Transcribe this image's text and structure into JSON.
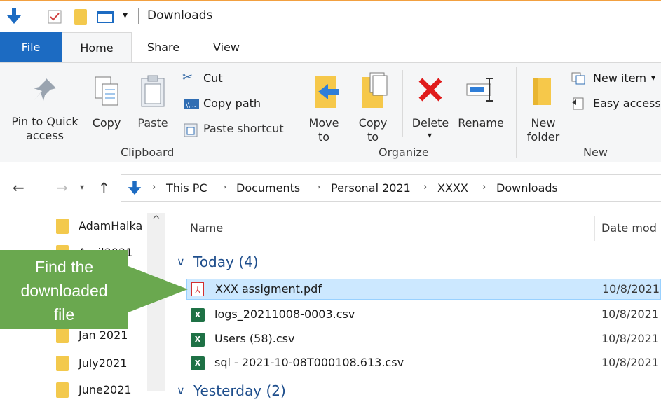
{
  "window": {
    "title": "Downloads"
  },
  "tabs": {
    "file": "File",
    "home": "Home",
    "share": "Share",
    "view": "View"
  },
  "ribbon": {
    "clipboard": {
      "pin": "Pin to Quick access",
      "copy": "Copy",
      "paste": "Paste",
      "cut": "Cut",
      "copy_path": "Copy path",
      "paste_shortcut": "Paste shortcut",
      "group": "Clipboard"
    },
    "organize": {
      "move_to": "Move to",
      "copy_to": "Copy to",
      "delete": "Delete",
      "rename": "Rename",
      "group": "Organize"
    },
    "new": {
      "new_folder": "New folder",
      "new_item": "New item",
      "easy_access": "Easy access",
      "group": "New"
    }
  },
  "address": {
    "crumbs": [
      "This PC",
      "Documents",
      "Personal 2021",
      "XXXX",
      "Downloads"
    ]
  },
  "nav": {
    "items": [
      "AdamHaika",
      "April2021",
      "Jan 2021",
      "July2021",
      "June2021"
    ]
  },
  "list": {
    "headers": {
      "name": "Name",
      "date": "Date mod"
    },
    "group_today": "Today (4)",
    "group_yesterday": "Yesterday (2)",
    "rows": [
      {
        "name": "XXX assigment.pdf",
        "date": "10/8/2021",
        "type": "pdf"
      },
      {
        "name": "logs_20211008-0003.csv",
        "date": "10/8/2021",
        "type": "csv"
      },
      {
        "name": "Users (58).csv",
        "date": "10/8/2021",
        "type": "csv"
      },
      {
        "name": "sql - 2021-10-08T000108.613.csv",
        "date": "10/8/2021",
        "type": "csv"
      }
    ]
  },
  "callout": {
    "line1": "Find the",
    "line2": "downloaded",
    "line3": "file"
  },
  "colors": {
    "accent": "#1c6bc2",
    "callout": "#6aa84f",
    "folder": "#f3c94d",
    "selection": "#cce8ff"
  }
}
